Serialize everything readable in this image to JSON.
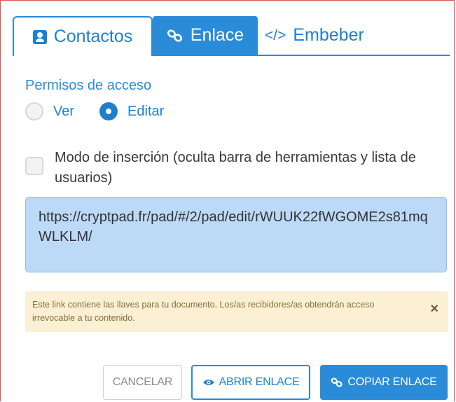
{
  "tabs": {
    "contacts": "Contactos",
    "link": "Enlace",
    "embed": "Embeber",
    "embed_prefix": "</>"
  },
  "access": {
    "label": "Permisos de acceso",
    "view": "Ver",
    "edit": "Editar",
    "selected": "edit"
  },
  "embed_mode": {
    "label": "Modo de inserción (oculta barra de herramientas y lista de usuarios)",
    "checked": false
  },
  "link_url": "https://cryptpad.fr/pad/#/2/pad/edit/rWUUK22fWGOME2s81mqWLKLM/",
  "warning": {
    "text": "Este link contiene las llaves para tu documento. Los/as recibidores/as obtendrán acceso irrevocable a tu contenido.",
    "close": "×"
  },
  "buttons": {
    "cancel": "CANCELAR",
    "open": "ABRIR ENLACE",
    "copy": "COPIAR ENLACE"
  },
  "icons": {
    "contacts": "contact-card-icon",
    "link": "link-icon",
    "open": "eye-icon",
    "copy": "link-icon",
    "close": "close-icon"
  },
  "colors": {
    "accent": "#2a8bd9",
    "link_box": "#bcd9f7",
    "warning_bg": "#fbefd4",
    "warning_text": "#8a6d3b"
  }
}
